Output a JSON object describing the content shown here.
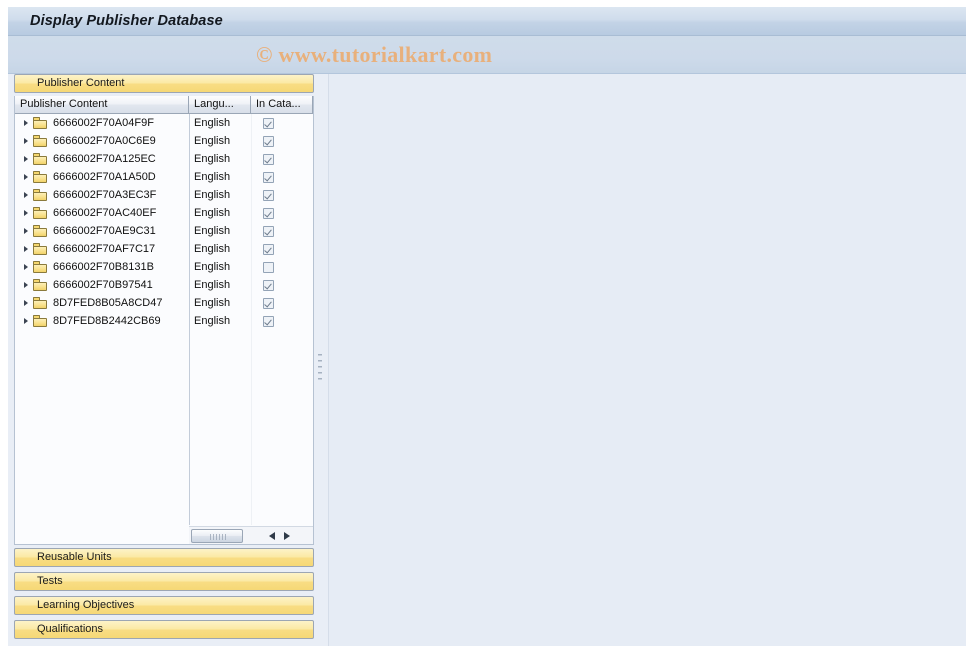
{
  "window": {
    "title": "Display Publisher Database",
    "watermark": "© www.tutorialkart.com"
  },
  "panels": {
    "publisher_content": {
      "header_label": "Publisher Content"
    },
    "collapsed": [
      {
        "label": "Reusable Units"
      },
      {
        "label": "Tests"
      },
      {
        "label": "Learning Objectives"
      },
      {
        "label": "Qualifications"
      }
    ]
  },
  "tree": {
    "columns": [
      {
        "label": "Publisher Content"
      },
      {
        "label": "Langu..."
      },
      {
        "label": "In Cata..."
      }
    ],
    "rows": [
      {
        "name": "6666002F70A04F9F",
        "language": "English",
        "in_catalog": true
      },
      {
        "name": "6666002F70A0C6E9",
        "language": "English",
        "in_catalog": true
      },
      {
        "name": "6666002F70A125EC",
        "language": "English",
        "in_catalog": true
      },
      {
        "name": "6666002F70A1A50D",
        "language": "English",
        "in_catalog": true
      },
      {
        "name": "6666002F70A3EC3F",
        "language": "English",
        "in_catalog": true
      },
      {
        "name": "6666002F70AC40EF",
        "language": "English",
        "in_catalog": true
      },
      {
        "name": "6666002F70AE9C31",
        "language": "English",
        "in_catalog": true
      },
      {
        "name": "6666002F70AF7C17",
        "language": "English",
        "in_catalog": true
      },
      {
        "name": "6666002F70B8131B",
        "language": "English",
        "in_catalog": false
      },
      {
        "name": "6666002F70B97541",
        "language": "English",
        "in_catalog": true
      },
      {
        "name": "8D7FED8B05A8CD47",
        "language": "English",
        "in_catalog": true
      },
      {
        "name": "8D7FED8B2442CB69",
        "language": "English",
        "in_catalog": true
      }
    ]
  },
  "colors": {
    "title_bar": "#cfdcec",
    "panel_header_yellow": "#f8dd84",
    "watermark": "#e8b07c",
    "canvas": "#e6ecf5",
    "folder_icon": "#f5d76e"
  }
}
